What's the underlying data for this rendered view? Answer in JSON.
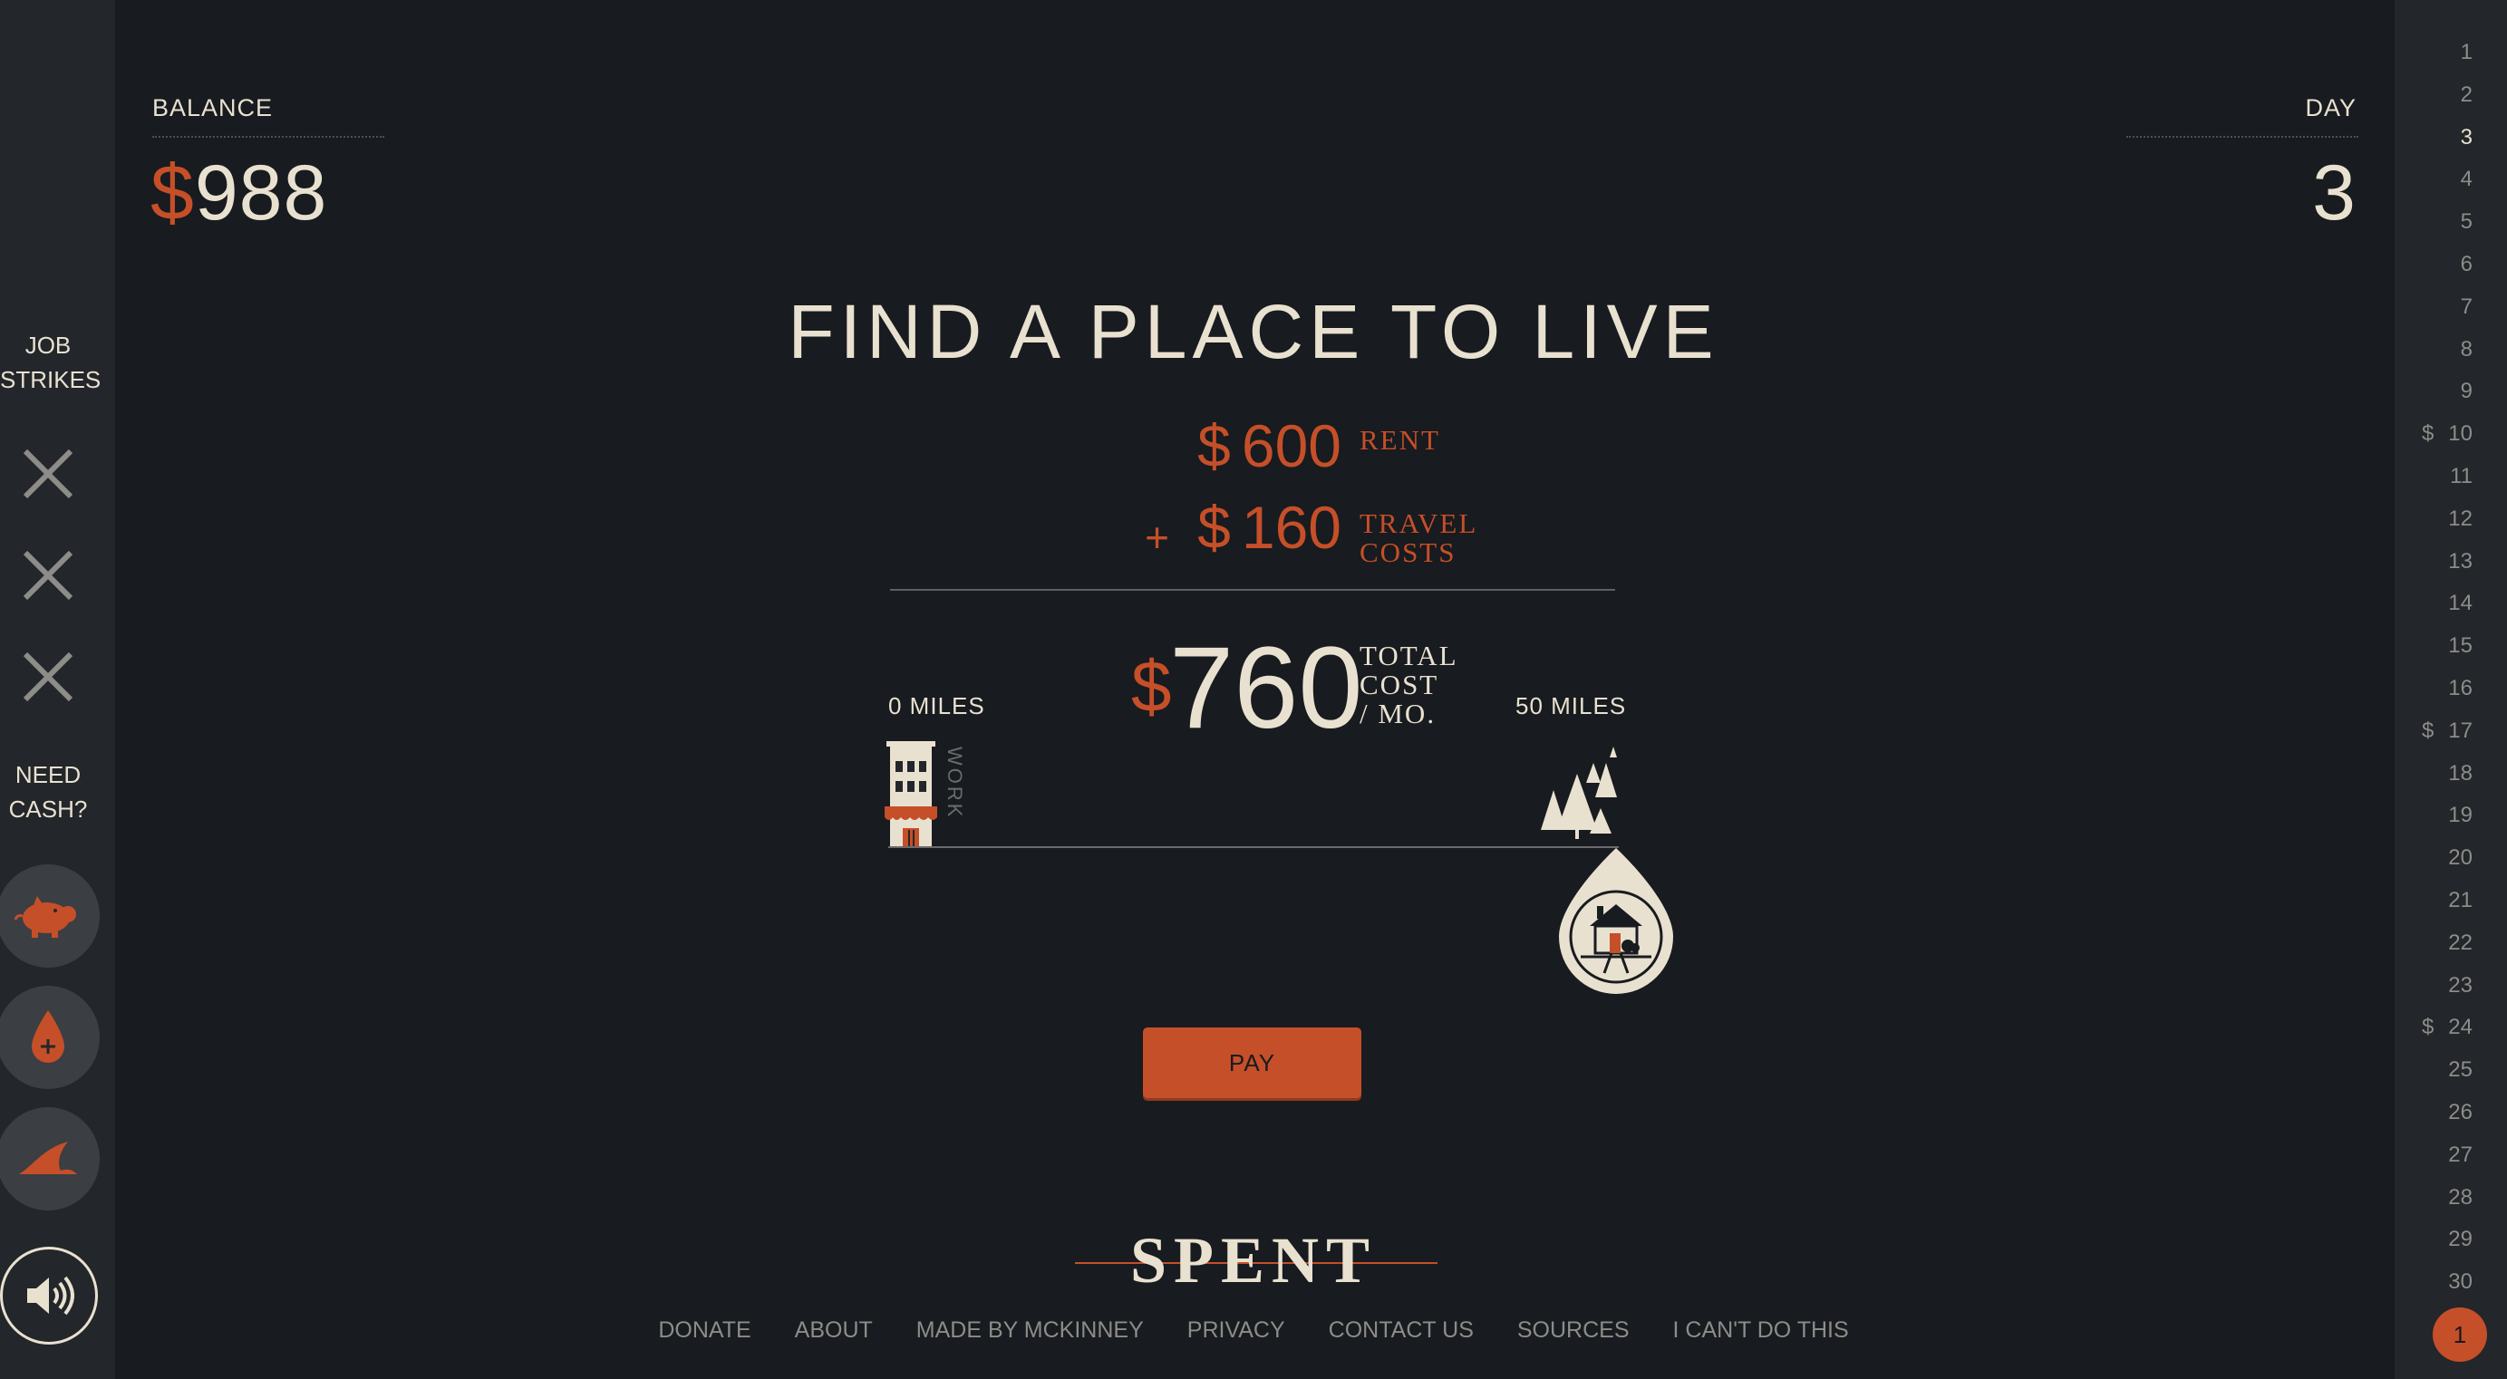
{
  "sidebar_left": {
    "job_strikes_label": [
      "JOB",
      "STRIKES"
    ],
    "need_cash_label": [
      "NEED",
      "CASH?"
    ],
    "buttons": [
      "piggy-bank-icon",
      "blood-drop-plus-icon",
      "shark-fin-icon",
      "speaker-icon"
    ]
  },
  "balance": {
    "label": "BALANCE",
    "currency": "$",
    "amount": "988"
  },
  "day": {
    "label": "DAY",
    "value": "3"
  },
  "main": {
    "title": "FIND A PLACE TO LIVE",
    "rent": {
      "currency": "$",
      "amount": "600",
      "label": "RENT"
    },
    "travel": {
      "operator": "+",
      "currency": "$",
      "amount": "160",
      "label_lines": [
        "TRAVEL",
        "COSTS"
      ]
    },
    "total": {
      "currency": "$",
      "amount": "760",
      "label_lines": [
        "TOTAL",
        "COST",
        "/ MO."
      ]
    },
    "distance": {
      "min_label": "0 MILES",
      "max_label": "50 MILES",
      "work_label": "WORK",
      "value_miles": 50
    },
    "pay_label": "PAY"
  },
  "calendar": {
    "days": [
      "1",
      "2",
      "3",
      "4",
      "5",
      "6",
      "7",
      "8",
      "9",
      "10",
      "11",
      "12",
      "13",
      "14",
      "15",
      "16",
      "17",
      "18",
      "19",
      "20",
      "21",
      "22",
      "23",
      "24",
      "25",
      "26",
      "27",
      "28",
      "29",
      "30"
    ],
    "current_day": "3",
    "dollar_marker": "$",
    "payment_days": [
      "10",
      "17",
      "24"
    ],
    "badge": "1"
  },
  "footer": {
    "logo": "SPENT",
    "links": [
      "DONATE",
      "ABOUT",
      "MADE BY MCKINNEY",
      "PRIVACY",
      "CONTACT US",
      "SOURCES",
      "I CAN'T DO THIS"
    ]
  },
  "colors": {
    "accent": "#c54f29",
    "text": "#e9e1d0",
    "background": "#181b1f",
    "sidebar": "#23262a",
    "muted": "#8d8c89"
  }
}
